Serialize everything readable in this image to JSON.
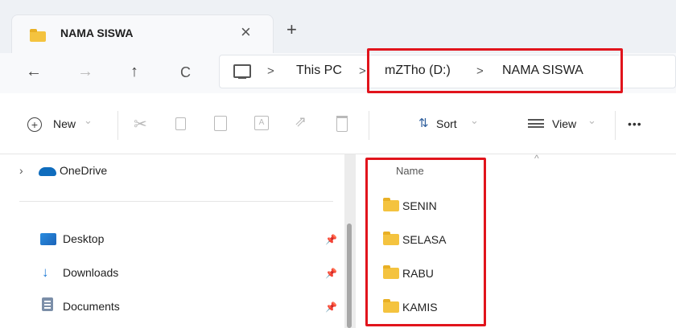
{
  "tab": {
    "title": "NAMA SISWA",
    "close_glyph": "×",
    "new_tab_glyph": "+"
  },
  "nav": {
    "back_glyph": "←",
    "forward_glyph": "→",
    "up_glyph": "↑",
    "refresh_glyph": "C"
  },
  "breadcrumb": {
    "separator": ">",
    "items": [
      "This PC",
      "mZTho (D:)",
      "NAMA SISWA"
    ]
  },
  "toolbar": {
    "new_label": "New",
    "sort_label": "Sort",
    "view_label": "View",
    "more_glyph": "•••",
    "dropdown_glyph": "⌄"
  },
  "sidebar": {
    "onedrive": "OneDrive",
    "items": [
      {
        "label": "Desktop",
        "icon": "desktop-icon"
      },
      {
        "label": "Downloads",
        "icon": "download-icon"
      },
      {
        "label": "Documents",
        "icon": "documents-icon"
      }
    ],
    "pin_glyph": "📌"
  },
  "files": {
    "column_name": "Name",
    "rows": [
      "SENIN",
      "SELASA",
      "RABU",
      "KAMIS"
    ]
  },
  "colors": {
    "highlight": "#e1141c",
    "folder": "#f4c33f",
    "onedrive": "#0f6cbd",
    "accent": "#0a63c9"
  }
}
